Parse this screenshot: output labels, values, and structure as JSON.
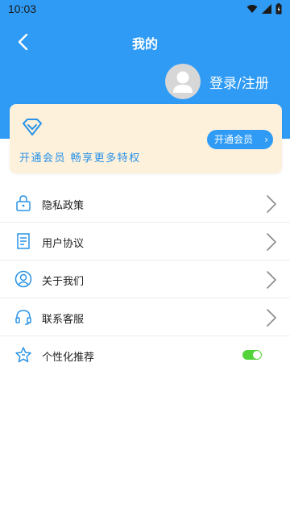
{
  "status_bar": {
    "time": "10:03",
    "icons": [
      "wifi-icon",
      "signal-icon",
      "battery-icon"
    ]
  },
  "nav": {
    "title": "我的",
    "back_icon": "chevron-left-icon"
  },
  "profile": {
    "login_label": "登录/注册",
    "avatar_icon": "user-avatar-icon"
  },
  "vip": {
    "icon": "diamond-icon",
    "promo_text": "开通会员 畅享更多特权",
    "button_label": "开通会员",
    "button_chevron": "›"
  },
  "menu": [
    {
      "label": "隐私政策",
      "icon": "lock-icon"
    },
    {
      "label": "用户协议",
      "icon": "document-icon"
    },
    {
      "label": "关于我们",
      "icon": "user-circle-icon"
    },
    {
      "label": "联系客服",
      "icon": "headset-icon"
    },
    {
      "label": "个性化推荐",
      "icon": "star-badge-icon",
      "toggle_on": true
    }
  ],
  "colors": {
    "header": "#2f9bf5",
    "vip_card": "#fdf1dc",
    "accent": "#2a93e8",
    "toggle_on": "#52d33a"
  }
}
